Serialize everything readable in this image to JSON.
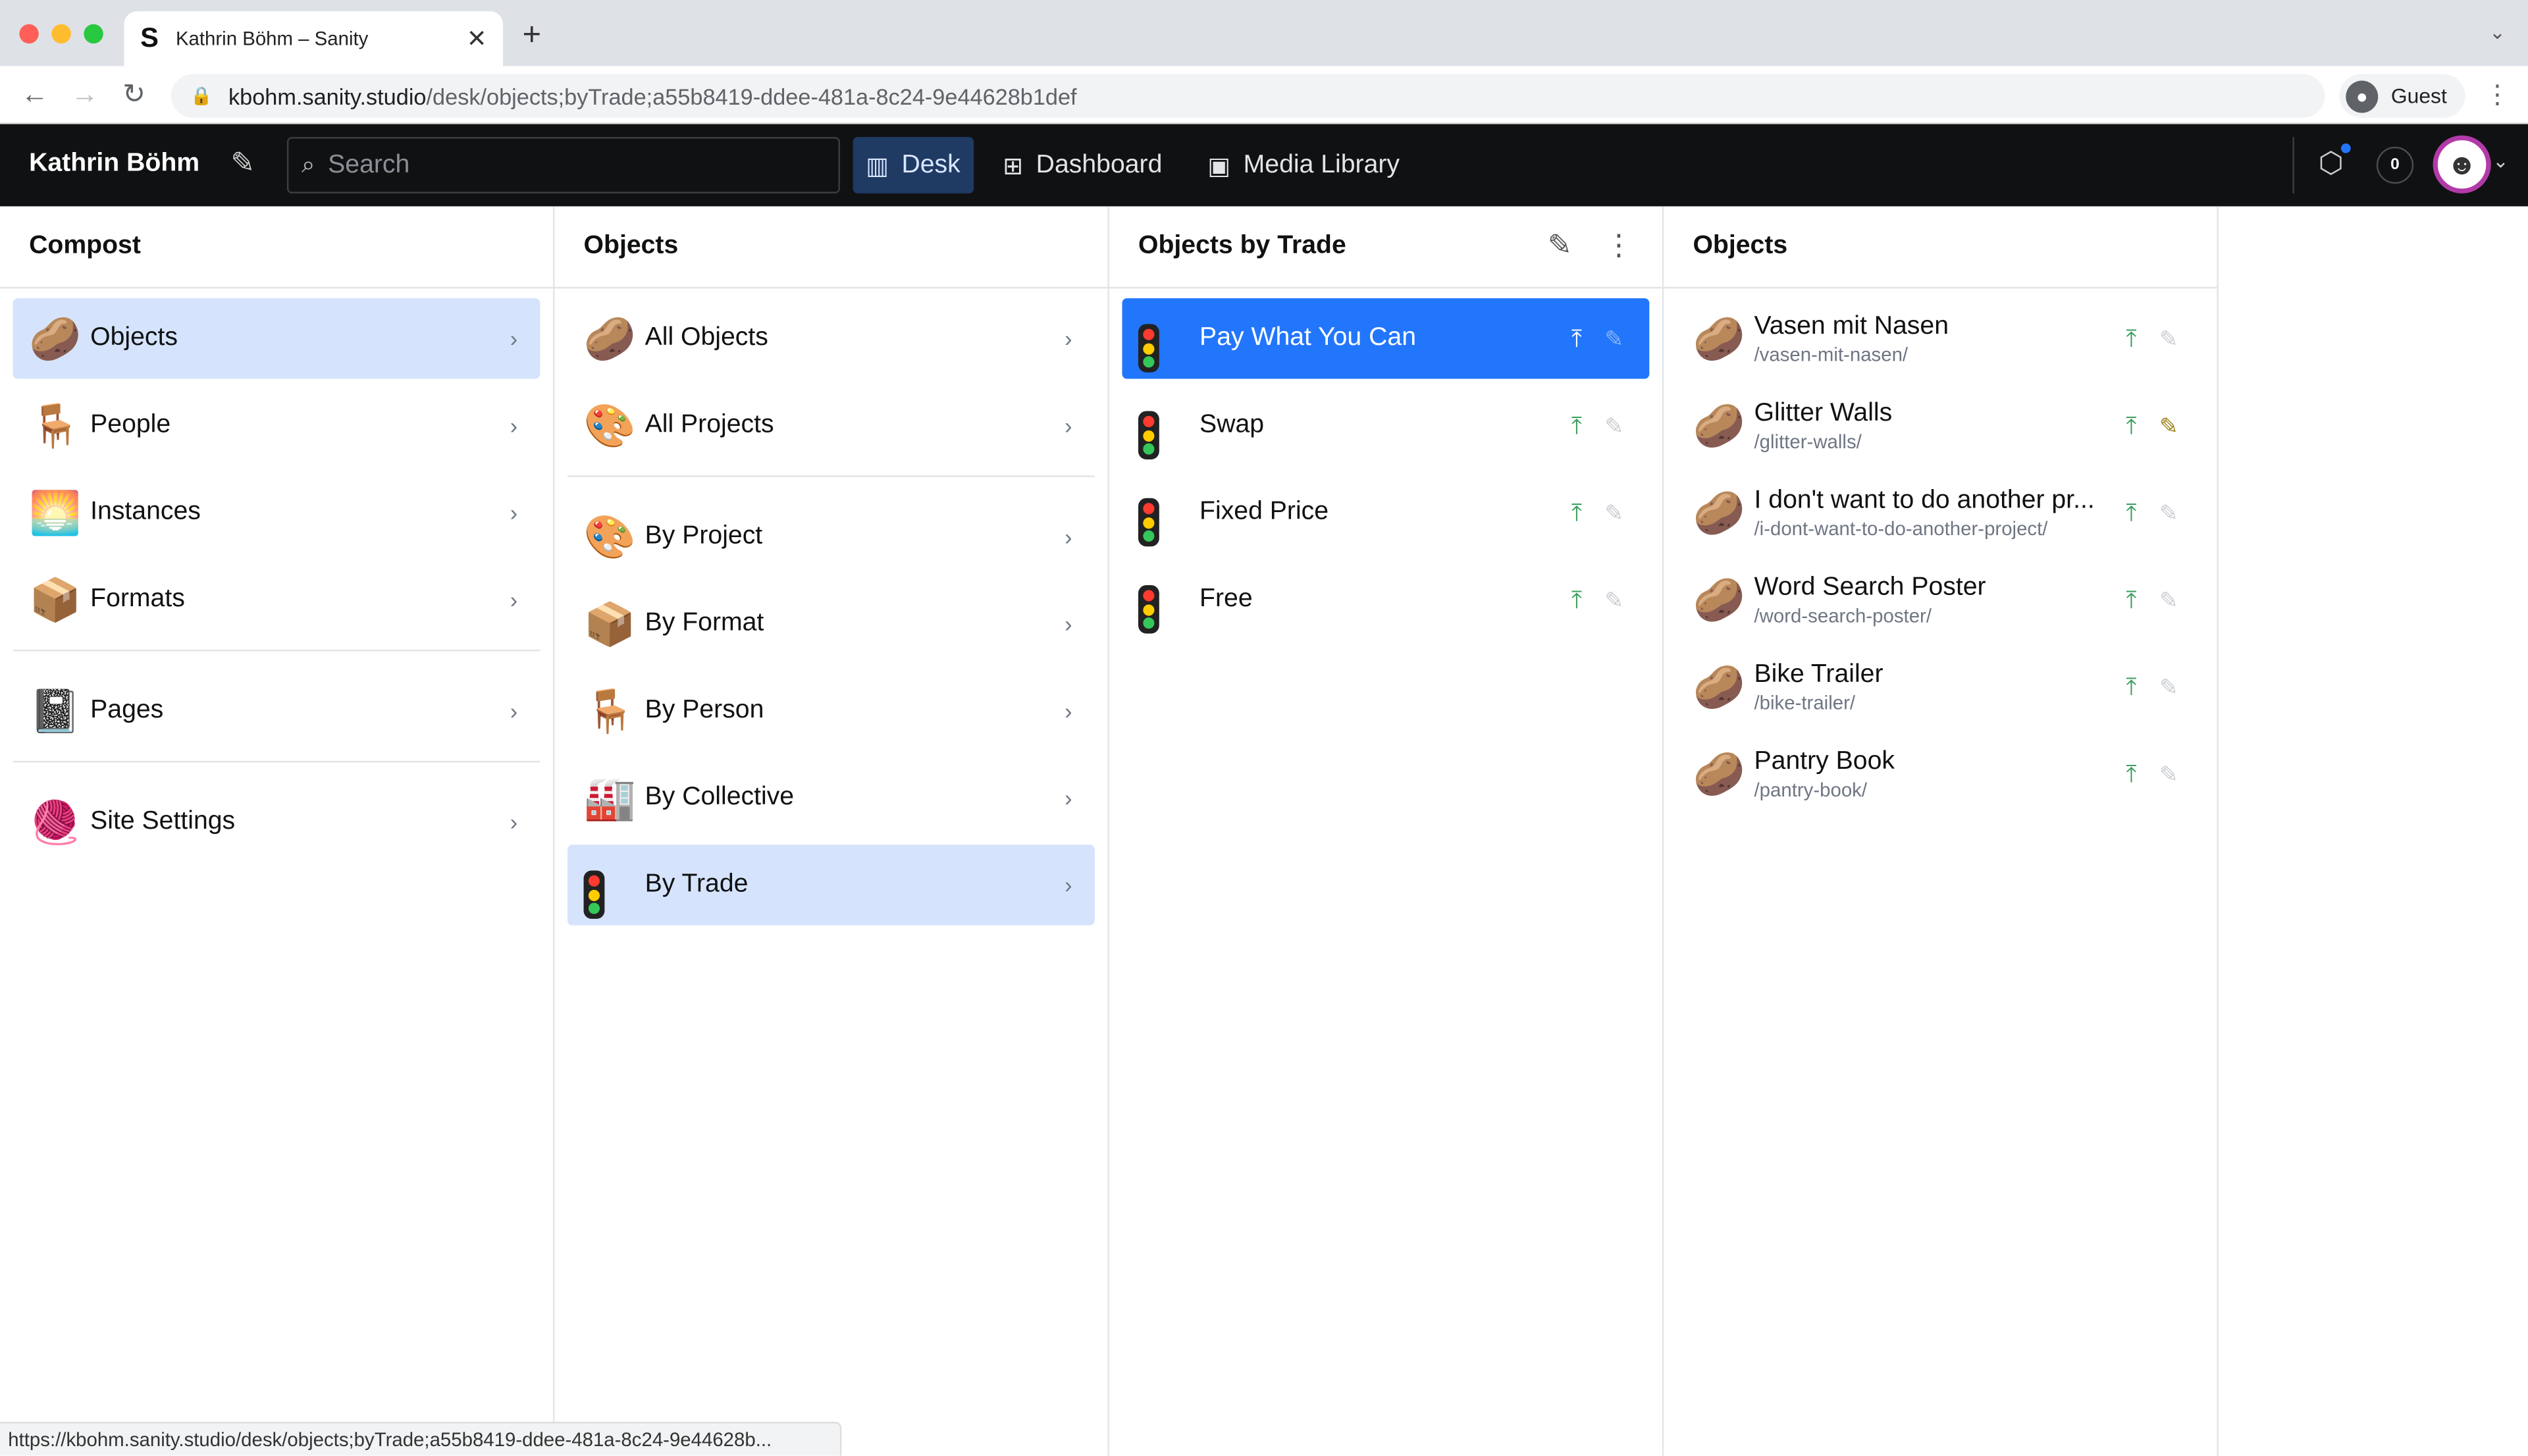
{
  "browser": {
    "tab_title": "Kathrin Böhm – Sanity",
    "tab_favicon": "S",
    "url_host": "kbohm.sanity.studio",
    "url_path": "/desk/objects;byTrade;a55b8419-ddee-481a-8c24-9e44628b1def",
    "profile_label": "Guest",
    "status_url": "https://kbohm.sanity.studio/desk/objects;byTrade;a55b8419-ddee-481a-8c24-9e44628b..."
  },
  "navbar": {
    "brand": "Kathrin Böhm",
    "search_placeholder": "Search",
    "tools": [
      {
        "label": "Desk",
        "icon": "desk-icon",
        "active": true
      },
      {
        "label": "Dashboard",
        "icon": "dashboard-icon",
        "active": false
      },
      {
        "label": "Media Library",
        "icon": "image-icon",
        "active": false
      }
    ],
    "notification_count": "0"
  },
  "pane1": {
    "title": "Compost",
    "items": [
      {
        "label": "Objects",
        "icon": "potato",
        "selected": true
      },
      {
        "label": "People",
        "icon": "chair"
      },
      {
        "label": "Instances",
        "icon": "sunrise"
      },
      {
        "label": "Formats",
        "icon": "package"
      },
      {
        "label": "Pages",
        "icon": "notebook"
      },
      {
        "label": "Site Settings",
        "icon": "yarn"
      }
    ]
  },
  "pane2": {
    "title": "Objects",
    "items": [
      {
        "label": "All Objects",
        "icon": "potato"
      },
      {
        "label": "All Projects",
        "icon": "palette"
      },
      {
        "label": "By Project",
        "icon": "palette"
      },
      {
        "label": "By Format",
        "icon": "package"
      },
      {
        "label": "By Person",
        "icon": "chair"
      },
      {
        "label": "By Collective",
        "icon": "factory"
      },
      {
        "label": "By Trade",
        "icon": "traffic-light",
        "selected": true
      }
    ]
  },
  "pane3": {
    "title": "Objects by Trade",
    "items": [
      {
        "label": "Pay What You Can",
        "active": true
      },
      {
        "label": "Swap"
      },
      {
        "label": "Fixed Price"
      },
      {
        "label": "Free"
      }
    ]
  },
  "pane4": {
    "title": "Objects",
    "docs": [
      {
        "title": "Vasen mit Nasen",
        "slug": "/vasen-mit-nasen/"
      },
      {
        "title": "Glitter Walls",
        "slug": "/glitter-walls/",
        "edited": true
      },
      {
        "title": "I don't want to do another pr...",
        "slug": "/i-dont-want-to-do-another-project/"
      },
      {
        "title": "Word Search Poster",
        "slug": "/word-search-poster/"
      },
      {
        "title": "Bike Trailer",
        "slug": "/bike-trailer/"
      },
      {
        "title": "Pantry Book",
        "slug": "/pantry-book/"
      }
    ]
  }
}
